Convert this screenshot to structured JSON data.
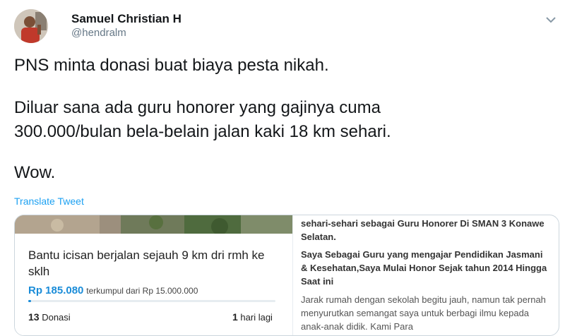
{
  "author": {
    "name": "Samuel Christian H",
    "handle": "@hendralm"
  },
  "tweet": {
    "line1": "PNS minta donasi buat biaya pesta nikah.",
    "line2": "Diluar sana ada guru honorer yang gajinya cuma",
    "line3": "300.000/bulan bela-belain jalan kaki 18 km sehari.",
    "line4": "Wow.",
    "translate_label": "Translate Tweet"
  },
  "card": {
    "campaign_title": "Bantu icisan berjalan sejauh 9 km dri rmh ke sklh",
    "raised_amount": "Rp 185.080",
    "raised_label": "terkumpul dari Rp 15.000.000",
    "progress_fraction": 0.012,
    "donations_count": "13",
    "donations_label": "Donasi",
    "days_count": "1",
    "days_label": "hari lagi",
    "desc_1": "sehari-sehari sebagai Guru Honorer Di SMAN 3 Konawe Selatan.",
    "desc_2": "Saya Sebagai Guru yang mengajar Pendidikan Jasmani & Kesehatan,Saya Mulai Honor Sejak tahun 2014 Hingga Saat ini",
    "desc_3": "Jarak rumah dengan sekolah begitu jauh, namun tak pernah menyurutkan semangat saya untuk berbagi ilmu kepada anak-anak didik. Kami Para"
  },
  "colors": {
    "link": "#1da1f2",
    "accent": "#1a8cd8",
    "muted": "#657786"
  },
  "icons": {
    "menu": "chevron-down-icon",
    "avatar": "avatar"
  }
}
